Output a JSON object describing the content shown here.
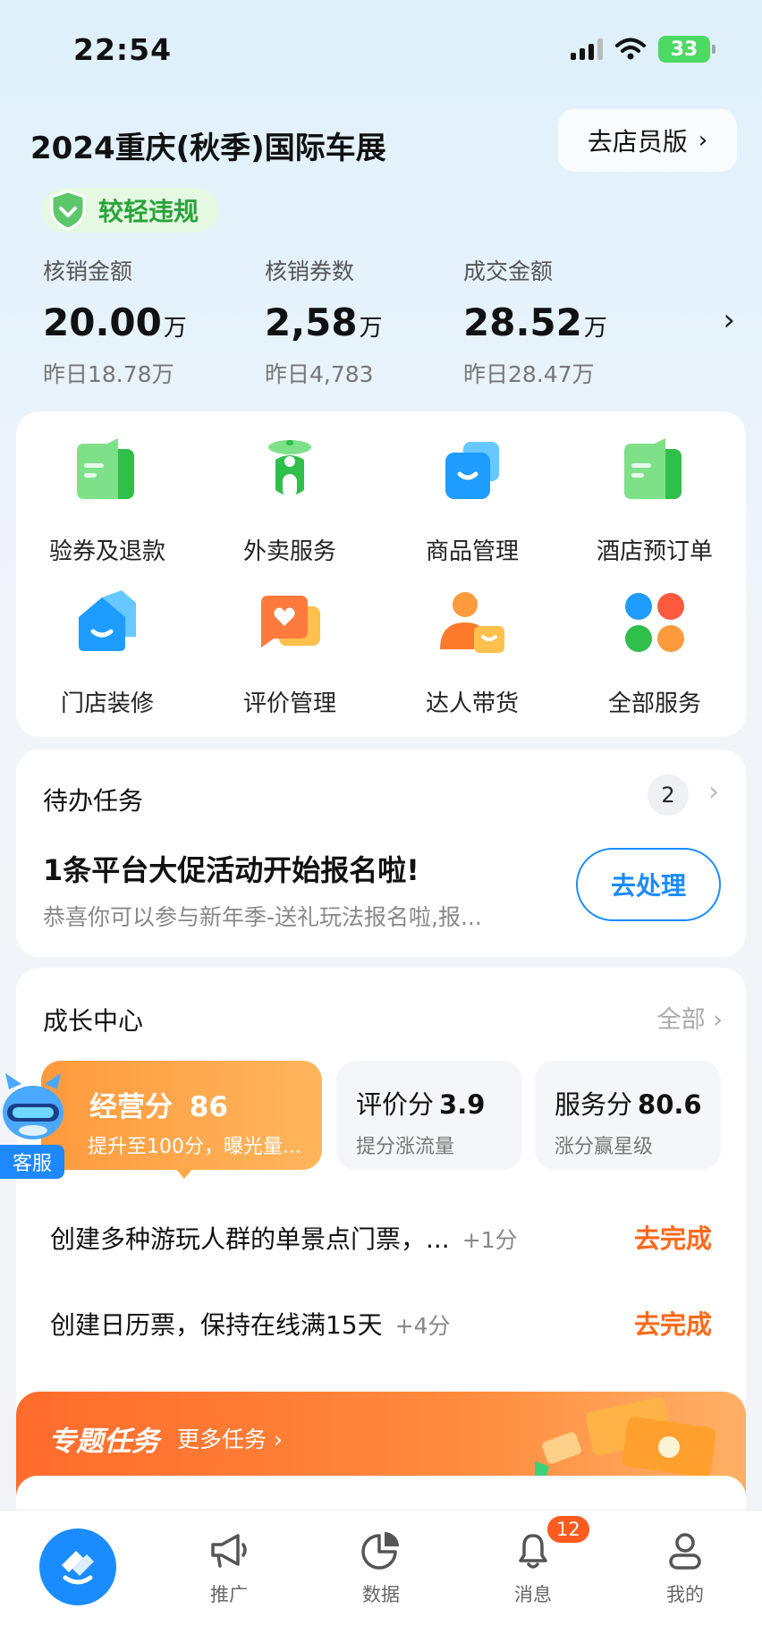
{
  "status_bar": {
    "time": "22:54",
    "battery": "33"
  },
  "header": {
    "store_name": "2024重庆(秋季)国际车展",
    "clerk_button": "去店员版",
    "violation_badge": "较轻违规"
  },
  "stats": [
    {
      "label": "核销金额",
      "value": "20.00",
      "unit": "万",
      "previous": "昨日18.78万"
    },
    {
      "label": "核销券数",
      "value": "2,58",
      "unit": "万",
      "previous": "昨日4,783"
    },
    {
      "label": "成交金额",
      "value": "28.52",
      "unit": "万",
      "previous": "昨日28.47万"
    }
  ],
  "services": [
    {
      "label": "验券及退款",
      "icon": "voucher-icon"
    },
    {
      "label": "外卖服务",
      "icon": "scooter-icon"
    },
    {
      "label": "商品管理",
      "icon": "goods-box-icon"
    },
    {
      "label": "酒店预订单",
      "icon": "hotel-order-icon"
    },
    {
      "label": "门店装修",
      "icon": "store-home-icon"
    },
    {
      "label": "评价管理",
      "icon": "review-heart-icon"
    },
    {
      "label": "达人带货",
      "icon": "influencer-icon"
    },
    {
      "label": "全部服务",
      "icon": "all-services-icon"
    }
  ],
  "todo": {
    "title": "待办任务",
    "count": "2",
    "headline": "1条平台大促活动开始报名啦!",
    "description": "恭喜你可以参与新年季-送礼玩法报名啦,报...",
    "action": "去处理"
  },
  "growth": {
    "title": "成长中心",
    "all_link": "全部",
    "main_score": {
      "label": "经营分",
      "value": "86",
      "subtitle": "提升至100分，曝光量..."
    },
    "scores": [
      {
        "label": "评价分",
        "value": "3.9",
        "subtitle": "提分涨流量"
      },
      {
        "label": "服务分",
        "value": "80.6",
        "subtitle": "涨分赢星级"
      }
    ],
    "tasks": [
      {
        "text": "创建多种游玩人群的单景点门票，...",
        "points": "+1分",
        "action": "去完成"
      },
      {
        "text": "创建日历票，保持在线满15天",
        "points": "+4分",
        "action": "去完成"
      }
    ]
  },
  "customer_service": {
    "label": "客服"
  },
  "special_tasks": {
    "title": "专题任务",
    "more": "更多任务"
  },
  "bottom_nav": {
    "items": [
      {
        "label": "推广",
        "icon": "megaphone-icon"
      },
      {
        "label": "数据",
        "icon": "pie-chart-icon"
      },
      {
        "label": "消息",
        "icon": "bell-icon"
      },
      {
        "label": "我的",
        "icon": "profile-icon"
      }
    ],
    "message_badge": "12"
  },
  "colors": {
    "accent": "#1a8cff",
    "orange": "#ff6a1a",
    "green": "#2aa33a"
  }
}
